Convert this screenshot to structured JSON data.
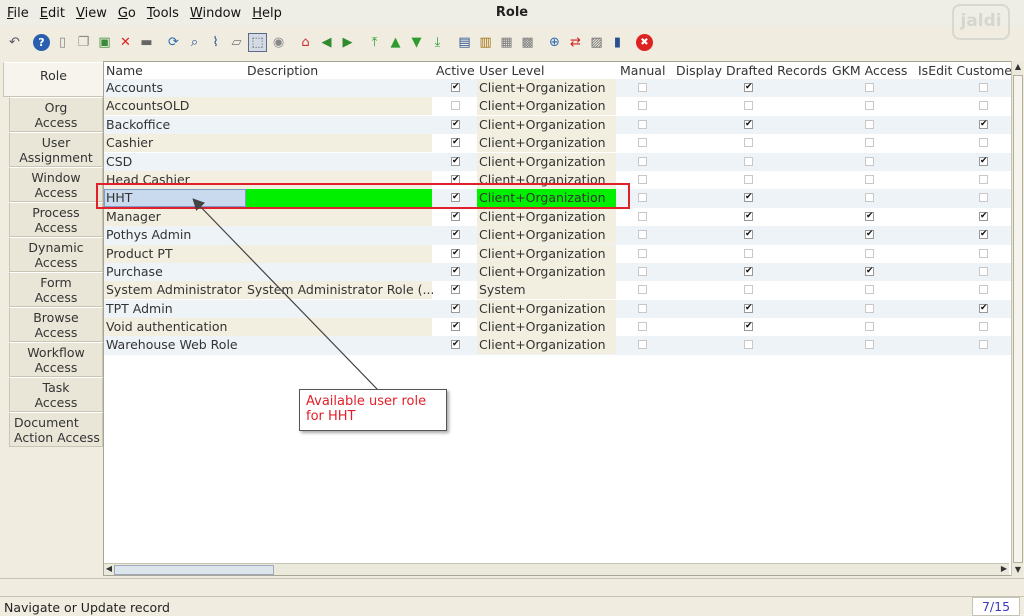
{
  "window": {
    "title": "Role",
    "logo": "jaldi"
  },
  "menu": [
    "File",
    "Edit",
    "View",
    "Go",
    "Tools",
    "Window",
    "Help"
  ],
  "toolbar": [
    "undo-icon",
    "help-icon",
    "new-icon",
    "copy-icon",
    "save-new-icon",
    "delete-icon",
    "save-icon",
    "refresh-icon",
    "find-icon",
    "attachment-icon",
    "chat-icon",
    "multi-view-icon",
    "history-icon",
    "home-icon",
    "back-icon",
    "forward-icon",
    "first-icon",
    "previous-icon",
    "next-icon",
    "last-icon",
    "report-icon",
    "archive-icon",
    "print-preview-icon",
    "print-icon",
    "zoom-icon",
    "workflow-icon",
    "request-icon",
    "product-icon",
    "close-icon"
  ],
  "side_tabs": [
    "Role",
    "Org\nAccess",
    "User\nAssignment",
    "Window\nAccess",
    "Process\nAccess",
    "Dynamic\nAccess",
    "Form\nAccess",
    "Browse\nAccess",
    "Workflow\nAccess",
    "Task\nAccess",
    "Document\nAction Access"
  ],
  "columns": [
    "Name",
    "Description",
    "Active",
    "User Level",
    "Manual",
    "Display Drafted Records",
    "GKM Access",
    "IsEdit Custome"
  ],
  "rows": [
    {
      "name": "Accounts",
      "description": "",
      "active": true,
      "level": "Client+Organization",
      "manual": false,
      "drafted": true,
      "gkm": false,
      "isedit": false
    },
    {
      "name": "AccountsOLD",
      "description": "",
      "active": false,
      "level": "Client+Organization",
      "manual": false,
      "drafted": false,
      "gkm": false,
      "isedit": false
    },
    {
      "name": "Backoffice",
      "description": "",
      "active": true,
      "level": "Client+Organization",
      "manual": false,
      "drafted": true,
      "gkm": false,
      "isedit": true
    },
    {
      "name": "Cashier",
      "description": "",
      "active": true,
      "level": "Client+Organization",
      "manual": false,
      "drafted": false,
      "gkm": false,
      "isedit": false
    },
    {
      "name": "CSD",
      "description": "",
      "active": true,
      "level": "Client+Organization",
      "manual": false,
      "drafted": false,
      "gkm": false,
      "isedit": true
    },
    {
      "name": "Head Cashier",
      "description": "",
      "active": true,
      "level": "Client+Organization",
      "manual": false,
      "drafted": false,
      "gkm": false,
      "isedit": false
    },
    {
      "name": "HHT",
      "description": "",
      "active": true,
      "level": "Client+Organization",
      "manual": false,
      "drafted": true,
      "gkm": false,
      "isedit": false,
      "selected": true
    },
    {
      "name": "Manager",
      "description": "",
      "active": true,
      "level": "Client+Organization",
      "manual": false,
      "drafted": true,
      "gkm": true,
      "isedit": true
    },
    {
      "name": "Pothys Admin",
      "description": "",
      "active": true,
      "level": "Client+Organization",
      "manual": false,
      "drafted": true,
      "gkm": true,
      "isedit": true
    },
    {
      "name": "Product PT",
      "description": "",
      "active": true,
      "level": "Client+Organization",
      "manual": false,
      "drafted": false,
      "gkm": false,
      "isedit": false
    },
    {
      "name": "Purchase",
      "description": "",
      "active": true,
      "level": "Client+Organization",
      "manual": false,
      "drafted": true,
      "gkm": true,
      "isedit": false
    },
    {
      "name": "System Administrator",
      "description": "System Administrator Role (...",
      "active": true,
      "level": "System",
      "manual": false,
      "drafted": false,
      "gkm": false,
      "isedit": false
    },
    {
      "name": "TPT Admin",
      "description": "",
      "active": true,
      "level": "Client+Organization",
      "manual": false,
      "drafted": true,
      "gkm": false,
      "isedit": true
    },
    {
      "name": "Void authentication",
      "description": "",
      "active": true,
      "level": "Client+Organization",
      "manual": false,
      "drafted": true,
      "gkm": false,
      "isedit": false
    },
    {
      "name": "Warehouse Web Role",
      "description": "",
      "active": true,
      "level": "Client+Organization",
      "manual": false,
      "drafted": false,
      "gkm": false,
      "isedit": false
    }
  ],
  "annotation": {
    "text": "Available user role\nfor HHT",
    "color": "#e0202a"
  },
  "status": {
    "message": "Navigate or Update record",
    "record_count": "7/15"
  }
}
